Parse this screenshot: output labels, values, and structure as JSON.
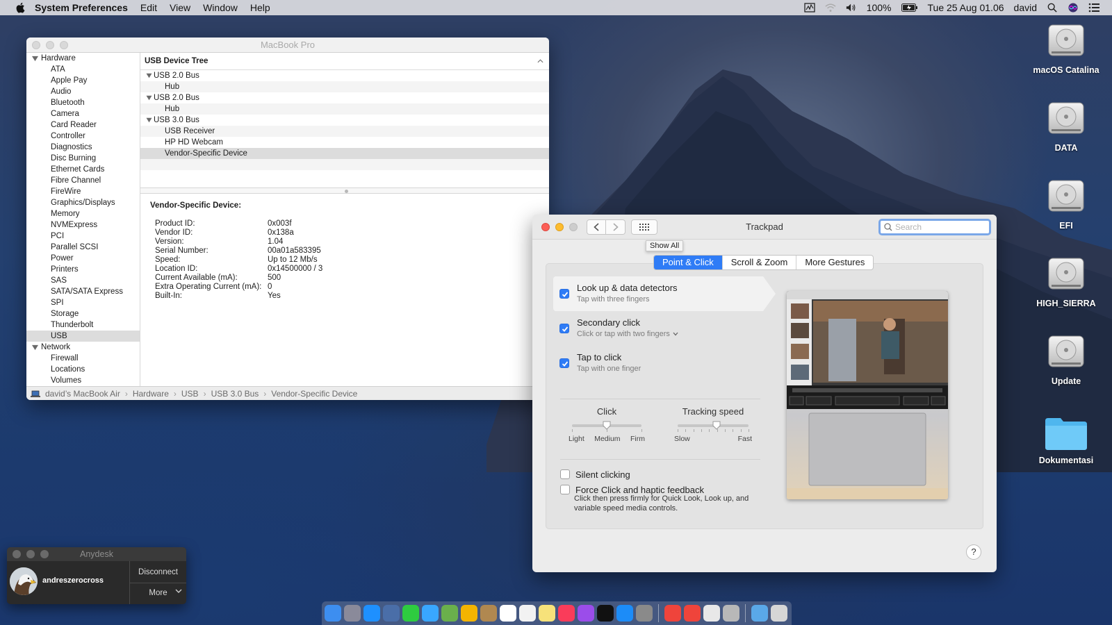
{
  "menubar": {
    "app_name": "System Preferences",
    "menus": [
      "Edit",
      "View",
      "Window",
      "Help"
    ],
    "battery": "100%",
    "datetime": "Tue 25 Aug  01.06",
    "user": "david"
  },
  "sysinfo": {
    "title": "MacBook Pro",
    "sidebar": {
      "hardware_label": "Hardware",
      "hardware_items": [
        "ATA",
        "Apple Pay",
        "Audio",
        "Bluetooth",
        "Camera",
        "Card Reader",
        "Controller",
        "Diagnostics",
        "Disc Burning",
        "Ethernet Cards",
        "Fibre Channel",
        "FireWire",
        "Graphics/Displays",
        "Memory",
        "NVMExpress",
        "PCI",
        "Parallel SCSI",
        "Power",
        "Printers",
        "SAS",
        "SATA/SATA Express",
        "SPI",
        "Storage",
        "Thunderbolt",
        "USB"
      ],
      "selected": "USB",
      "network_label": "Network",
      "network_items": [
        "Firewall",
        "Locations",
        "Volumes"
      ]
    },
    "tree_header": "USB Device Tree",
    "tree": [
      {
        "kind": "bus",
        "label": "USB 2.0 Bus"
      },
      {
        "kind": "dev",
        "label": "Hub"
      },
      {
        "kind": "bus",
        "label": "USB 2.0 Bus"
      },
      {
        "kind": "dev",
        "label": "Hub"
      },
      {
        "kind": "bus",
        "label": "USB 3.0 Bus"
      },
      {
        "kind": "dev",
        "label": "USB Receiver"
      },
      {
        "kind": "dev",
        "label": "HP HD Webcam"
      },
      {
        "kind": "dev",
        "label": "Vendor-Specific Device",
        "selected": true
      }
    ],
    "detail_title": "Vendor-Specific Device:",
    "details": [
      {
        "key": "Product ID:",
        "value": "0x003f"
      },
      {
        "key": "Vendor ID:",
        "value": "0x138a"
      },
      {
        "key": "Version:",
        "value": "1.04"
      },
      {
        "key": "Serial Number:",
        "value": "00a01a583395"
      },
      {
        "key": "Speed:",
        "value": "Up to 12 Mb/s"
      },
      {
        "key": "Location ID:",
        "value": "0x14500000 / 3"
      },
      {
        "key": "Current Available (mA):",
        "value": "500"
      },
      {
        "key": "Extra Operating Current (mA):",
        "value": "0"
      },
      {
        "key": "Built-In:",
        "value": "Yes"
      }
    ],
    "breadcrumb": [
      "david’s MacBook Air",
      "Hardware",
      "USB",
      "USB 3.0 Bus",
      "Vendor-Specific Device"
    ]
  },
  "trackpad": {
    "title": "Trackpad",
    "search_placeholder": "Search",
    "tooltip": "Show All",
    "tabs": [
      {
        "label": "Point & Click",
        "active": true
      },
      {
        "label": "Scroll & Zoom",
        "active": false
      },
      {
        "label": "More Gestures",
        "active": false
      }
    ],
    "options": [
      {
        "label": "Look up & data detectors",
        "sub": "Tap with three fingers",
        "checked": true
      },
      {
        "label": "Secondary click",
        "sub": "Click or tap with two fingers",
        "checked": true
      },
      {
        "label": "Tap to click",
        "sub": "Tap with one finger",
        "checked": true
      }
    ],
    "click_slider": {
      "title": "Click",
      "labels": [
        "Light",
        "Medium",
        "Firm"
      ],
      "level": 0.5
    },
    "speed_slider": {
      "title": "Tracking speed",
      "labels": [
        "Slow",
        "Fast"
      ],
      "level": 0.55
    },
    "silent_clicking": {
      "label": "Silent clicking",
      "checked": false
    },
    "force_click": {
      "label": "Force Click and haptic feedback",
      "checked": false,
      "desc": "Click then press firmly for Quick Look, Look up, and variable speed media controls."
    },
    "help": "?"
  },
  "desktop_icons": [
    "macOS Catalina",
    "DATA",
    "EFI",
    "HIGH_SIERRA",
    "Update",
    "Dokumentasi"
  ],
  "anydesk": {
    "title": "Anydesk",
    "username": "andreszerocross",
    "disconnect": "Disconnect",
    "more": "More"
  },
  "colors": {
    "accent": "#2f7cf6",
    "close": "#fc5f57",
    "minimize": "#fdbc2e",
    "inactive": "#cdcdcd"
  }
}
